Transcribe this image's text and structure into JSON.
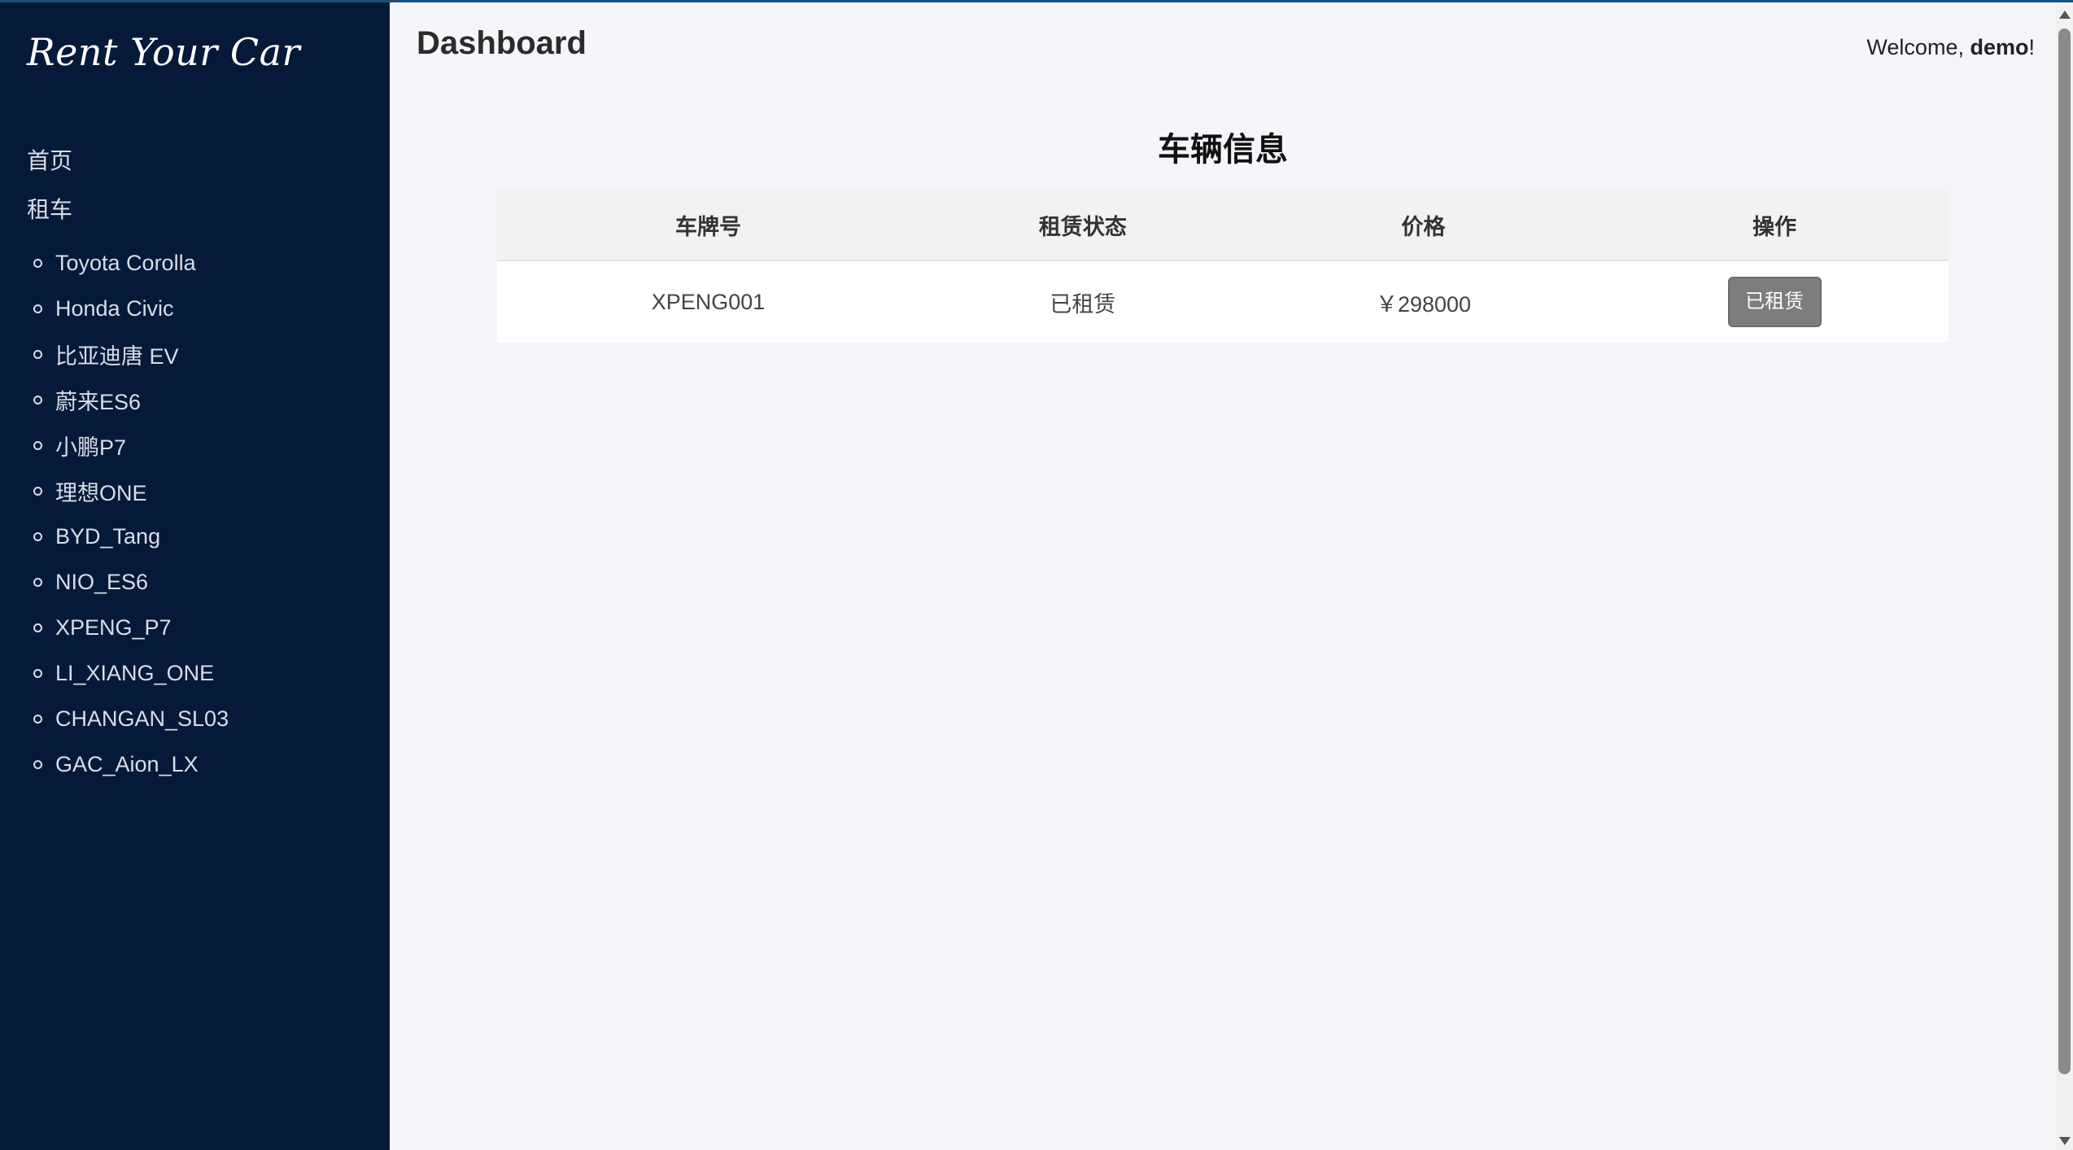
{
  "brand": "Rent Your Car",
  "sidebar": {
    "home_label": "首页",
    "rent_label": "租车",
    "cars": [
      "Toyota Corolla",
      "Honda Civic",
      "比亚迪唐 EV",
      "蔚来ES6",
      "小鹏P7",
      "理想ONE",
      "BYD_Tang",
      "NIO_ES6",
      "XPENG_P7",
      "LI_XIANG_ONE",
      "CHANGAN_SL03",
      "GAC_Aion_LX"
    ]
  },
  "header": {
    "title": "Dashboard",
    "welcome_prefix": "Welcome, ",
    "username": "demo",
    "welcome_suffix": "!"
  },
  "main": {
    "section_title": "车辆信息",
    "columns": [
      "车牌号",
      "租赁状态",
      "价格",
      "操作"
    ],
    "rows": [
      {
        "plate": "XPENG001",
        "status": "已租赁",
        "price": "￥298000",
        "action": "已租赁"
      }
    ]
  },
  "colors": {
    "sidebar_bg": "#051a38",
    "page_bg": "#f4f6f9",
    "button_bg": "#7d7d7d"
  }
}
